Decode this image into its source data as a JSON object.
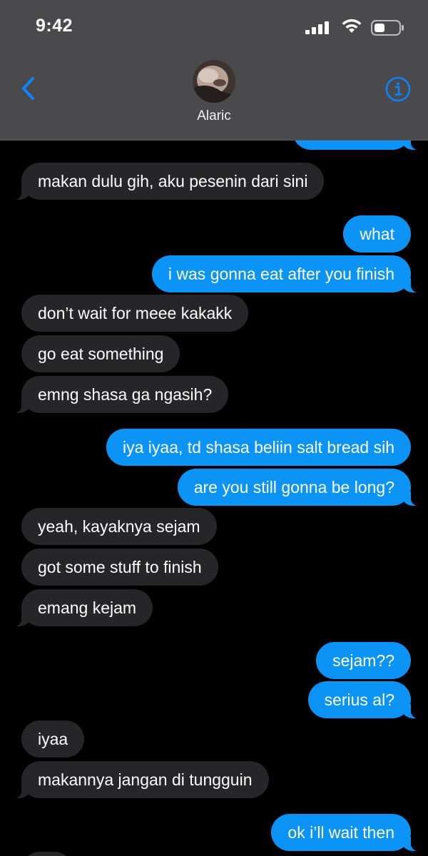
{
  "status_bar": {
    "time": "9:42"
  },
  "header": {
    "contact_name": "Alaric",
    "back_icon": "chevron-left-icon",
    "info_icon": "info-icon",
    "accent": "#0a84ff"
  },
  "colors": {
    "sent": "#0b93f6",
    "received": "#262628",
    "header_bg": "#4a4a4c"
  },
  "messages": [
    {
      "from": "received",
      "text": "makan dulu gih, aku pesenin dari sini"
    },
    {
      "from": "sent",
      "text": "what"
    },
    {
      "from": "sent",
      "text": "i was gonna eat after you finish"
    },
    {
      "from": "received",
      "text": "don’t wait for meee kakakk"
    },
    {
      "from": "received",
      "text": "go eat something"
    },
    {
      "from": "received",
      "text": "emng shasa ga ngasih?"
    },
    {
      "from": "sent",
      "text": "iya iyaa, td shasa beliin salt bread sih"
    },
    {
      "from": "sent",
      "text": "are you still gonna be long?"
    },
    {
      "from": "received",
      "text": "yeah, kayaknya sejam"
    },
    {
      "from": "received",
      "text": "got some stuff to finish"
    },
    {
      "from": "received",
      "text": "emang kejam"
    },
    {
      "from": "sent",
      "text": "sejam??"
    },
    {
      "from": "sent",
      "text": "serius al?"
    },
    {
      "from": "received",
      "text": "iyaa"
    },
    {
      "from": "received",
      "text": "makannya jangan di tungguin"
    },
    {
      "from": "sent",
      "text": "ok i’ll wait then"
    }
  ]
}
